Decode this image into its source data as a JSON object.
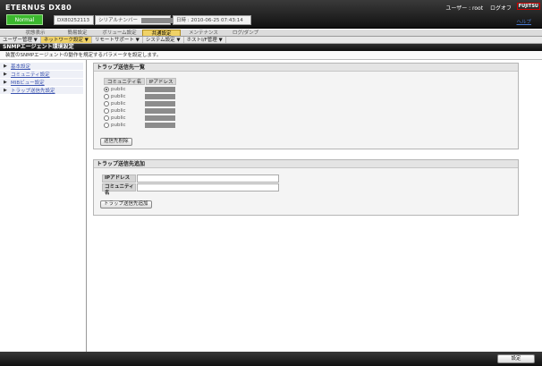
{
  "app": {
    "title": "ETERNUS DX80",
    "status": "Normal",
    "device_id": "DX80252113",
    "serial_label": "シリアルナンバー",
    "datetime": "日時 : 2010-06-25 07:43:14",
    "user": "ユーザー : root",
    "logout": "ログオフ",
    "vendor": "FUJITSU",
    "help": "ヘルプ"
  },
  "tabs": [
    {
      "label": "状態表示"
    },
    {
      "label": "簡易設定"
    },
    {
      "label": "ボリューム設定"
    },
    {
      "label": "共通設定"
    },
    {
      "label": "メンテナンス"
    },
    {
      "label": "ログ/ダンプ"
    }
  ],
  "submenu": [
    {
      "label": "ユーザー管理 ▼"
    },
    {
      "label": "ネットワーク設定 ▼"
    },
    {
      "label": "リモートサポート ▼"
    },
    {
      "label": "システム設定 ▼"
    },
    {
      "label": "ホストI/F管理 ▼"
    }
  ],
  "page": {
    "title": "SNMPエージェント環境設定",
    "description": "装置のSNMPエージェントの動作を規定するパラメータを設定します。"
  },
  "sidebar": {
    "items": [
      {
        "label": "基本設定"
      },
      {
        "label": "コミュニティ設定"
      },
      {
        "label": "MIBビュー設定"
      },
      {
        "label": "トラップ送信先設定"
      }
    ]
  },
  "trap_list": {
    "title": "トラップ送信先一覧",
    "col_community": "コミュニティ名",
    "col_ip": "IPアドレス",
    "rows": [
      {
        "community": "public",
        "selected": true
      },
      {
        "community": "public",
        "selected": false
      },
      {
        "community": "public",
        "selected": false
      },
      {
        "community": "public",
        "selected": false
      },
      {
        "community": "public",
        "selected": false
      },
      {
        "community": "public",
        "selected": false
      }
    ],
    "delete_button": "送信先削除"
  },
  "trap_add": {
    "title": "トラップ送信先追加",
    "ip_label": "IPアドレス",
    "ip_value": "",
    "community_label": "コミュニティ名",
    "community_value": "",
    "add_button": "トラップ送信先追加"
  },
  "footer": {
    "apply_button": "設定"
  },
  "colors": {
    "status_ok": "#3bb82e",
    "active_tab": "#f0d266",
    "link": "#3d55b0"
  }
}
